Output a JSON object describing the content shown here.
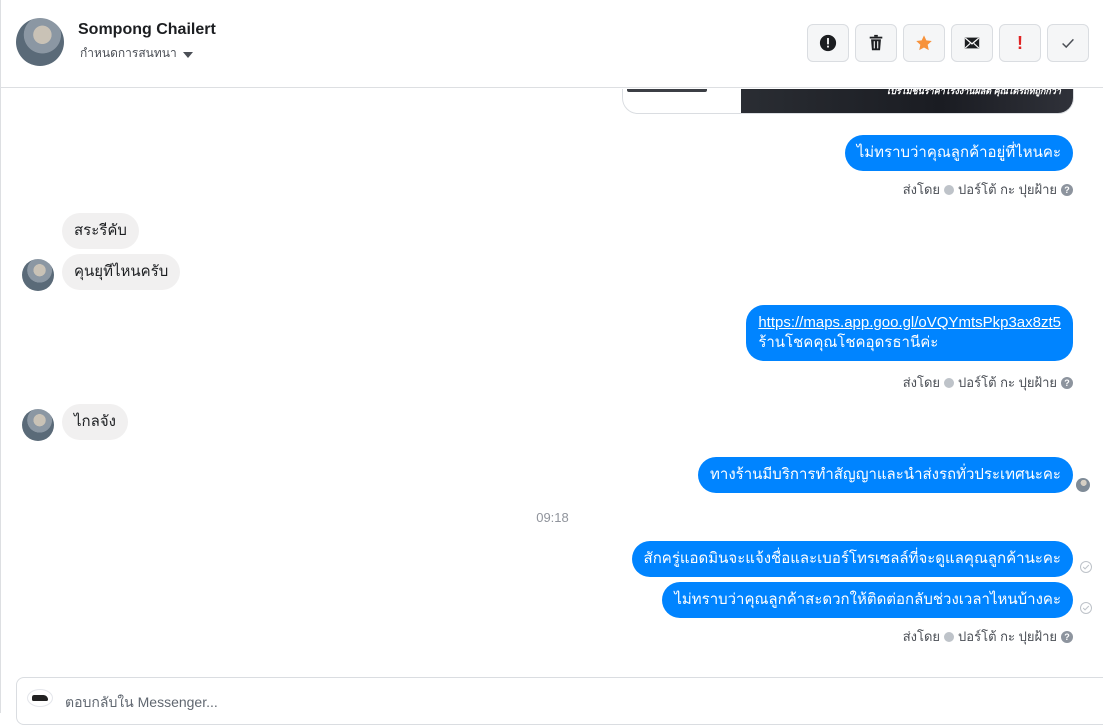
{
  "header": {
    "contact_name": "Sompong Chailert",
    "conversation_setting": "กำหนดการสนทนา",
    "toolbar": [
      {
        "name": "alert-icon",
        "kind": "info"
      },
      {
        "name": "trash-icon",
        "kind": "delete"
      },
      {
        "name": "star-icon",
        "kind": "star",
        "color": "#f7923b"
      },
      {
        "name": "envelope-icon",
        "kind": "mail"
      },
      {
        "name": "spam-icon",
        "kind": "spam",
        "label": "!"
      },
      {
        "name": "check-icon",
        "kind": "done"
      }
    ]
  },
  "image_preview": {
    "promo_text": "โปรโมชั่นราคาโรงงานผลิต คุณได้รถที่ถูกกว่า"
  },
  "messages": [
    {
      "side": "out",
      "text": "ไม่ทราบว่าคุณลูกค้าอยู่ที่ไหนคะ"
    },
    {
      "side": "meta",
      "sent_by": "ส่งโดย",
      "sender": "ปอร์โต้ กะ ปุยฝ้าย"
    },
    {
      "side": "in",
      "text": "สระรีคับ"
    },
    {
      "side": "in",
      "text": "คุนยุทีไหนครับ"
    },
    {
      "side": "out",
      "link": "https://maps.app.goo.gl/oVQYmtsPkp3ax8zt5",
      "text": "ร้านโชคคุณโชคอุดรธานีค่ะ"
    },
    {
      "side": "meta",
      "sent_by": "ส่งโดย",
      "sender": "ปอร์โต้ กะ ปุยฝ้าย"
    },
    {
      "side": "in",
      "text": "ไกลจัง"
    },
    {
      "side": "out",
      "text": "ทางร้านมีบริการทำสัญญาและนำส่งรถทั่วประเทศนะคะ"
    },
    {
      "side": "time",
      "text": "09:18"
    },
    {
      "side": "out",
      "text": "สักครู่แอดมินจะแจ้งชื่อและเบอร์โทรเซลล์ที่จะดูแลคุณลูกค้านะคะ"
    },
    {
      "side": "out",
      "text": "ไม่ทราบว่าคุณลูกค้าสะดวกให้ติดต่อกลับช่วงเวลาไหนบ้างคะ"
    },
    {
      "side": "meta",
      "sent_by": "ส่งโดย",
      "sender": "ปอร์โต้ กะ ปุยฝ้าย"
    }
  ],
  "composer": {
    "placeholder": "ตอบกลับใน Messenger..."
  },
  "colors": {
    "outgoing_bubble": "#0084ff",
    "incoming_bubble": "#f1f0f0",
    "star_accent": "#f7923b",
    "spam_accent": "#e02424"
  }
}
